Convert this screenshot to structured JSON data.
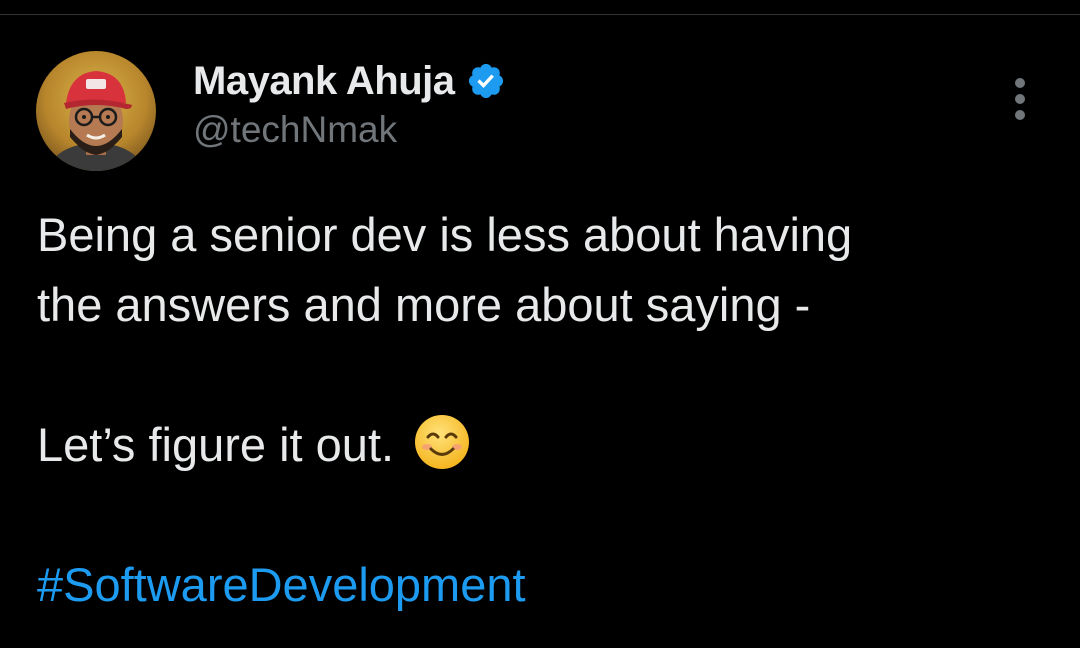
{
  "author": {
    "display_name": "Mayank Ahuja",
    "handle": "@techNmak",
    "verified": true,
    "avatar_icon": "avatar-photo"
  },
  "tweet": {
    "line_1": "Being a senior dev is less about having",
    "line_2": "the answers and more about saying -",
    "line_3": "Let’s figure it out.",
    "line_3_emoji": "smiling-face-icon",
    "hashtag": "#SoftwareDevelopment"
  },
  "menu_icon": "more-vertical-icon",
  "colors": {
    "background": "#000000",
    "text_primary": "#e7e9ea",
    "text_secondary": "#71767b",
    "accent": "#1d9bf0"
  }
}
